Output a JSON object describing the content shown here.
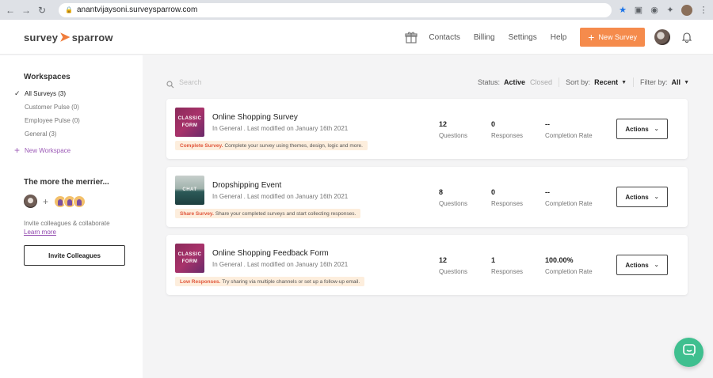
{
  "browser": {
    "url": "anantvijaysoni.surveysparrow.com"
  },
  "header": {
    "logo_left": "survey",
    "logo_right": "sparrow",
    "nav": [
      "Contacts",
      "Billing",
      "Settings",
      "Help"
    ],
    "new_survey_label": "New Survey",
    "accent_color": "#f58b4c"
  },
  "sidebar": {
    "workspaces_title": "Workspaces",
    "items": [
      {
        "label": "All Surveys (3)",
        "active": true
      },
      {
        "label": "Customer Pulse (0)",
        "active": false
      },
      {
        "label": "Employee Pulse (0)",
        "active": false
      },
      {
        "label": "General (3)",
        "active": false
      }
    ],
    "new_workspace_label": "New Workspace",
    "merrier_title": "The more the merrier...",
    "invite_text": "Invite colleagues & collaborate",
    "learn_more": "Learn more",
    "invite_button": "Invite Colleagues"
  },
  "toolbar": {
    "search_placeholder": "Search",
    "status_label": "Status:",
    "status_active": "Active",
    "status_closed": "Closed",
    "sort_label": "Sort by:",
    "sort_value": "Recent",
    "filter_label": "Filter by:",
    "filter_value": "All"
  },
  "surveys": [
    {
      "thumb": "CLASSIC\nFORM",
      "title": "Online Shopping Survey",
      "subtitle": "In General . Last modified on January 16th 2021",
      "hint_lead": "Complete Survey.",
      "hint_text": "Complete your survey using themes, design, logic and more.",
      "questions": "12",
      "responses": "0",
      "completion": "--",
      "questions_label": "Questions",
      "responses_label": "Responses",
      "completion_label": "Completion Rate",
      "actions_label": "Actions"
    },
    {
      "thumb": "CHAT",
      "title": "Dropshipping Event",
      "subtitle": "In General . Last modified on January 16th 2021",
      "hint_lead": "Share Survey.",
      "hint_text": "Share your completed surveys and start collecting responses.",
      "questions": "8",
      "responses": "0",
      "completion": "--",
      "questions_label": "Questions",
      "responses_label": "Responses",
      "completion_label": "Completion Rate",
      "actions_label": "Actions"
    },
    {
      "thumb": "CLASSIC\nFORM",
      "title": "Online Shopping Feedback Form",
      "subtitle": "In General . Last modified on January 16th 2021",
      "hint_lead": "Low Responses.",
      "hint_text": "Try sharing via multiple channels or set up a follow-up email.",
      "questions": "12",
      "responses": "1",
      "completion": "100.00%",
      "questions_label": "Questions",
      "responses_label": "Responses",
      "completion_label": "Completion Rate",
      "actions_label": "Actions"
    }
  ]
}
